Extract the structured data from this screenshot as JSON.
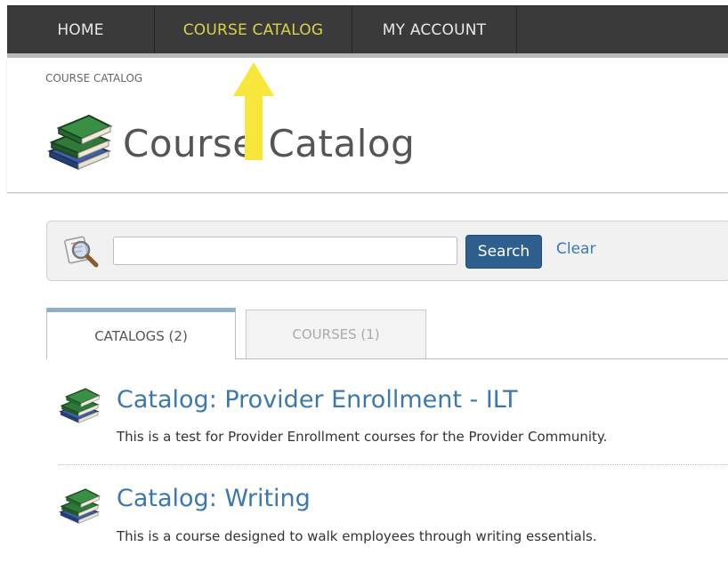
{
  "nav": {
    "items": [
      {
        "label": "HOME"
      },
      {
        "label": "COURSE CATALOG"
      },
      {
        "label": "MY ACCOUNT"
      }
    ],
    "active_color": "#d9d24a"
  },
  "breadcrumb": "COURSE CATALOG",
  "page_title": "Course Catalog",
  "search": {
    "value": "",
    "button_label": "Search",
    "clear_label": "Clear"
  },
  "tabs": [
    {
      "label": "CATALOGS (2)",
      "active": true
    },
    {
      "label": "COURSES (1)",
      "active": false
    }
  ],
  "catalogs": [
    {
      "title": "Catalog: Provider Enrollment - ILT",
      "description": "This is a test for Provider Enrollment courses for the Provider Community."
    },
    {
      "title": "Catalog: Writing",
      "description": "This is a course designed to walk employees through writing essentials."
    }
  ],
  "icons": {
    "books": "books-icon",
    "search": "magnifier-icon",
    "annotation": "arrow-up-icon"
  },
  "colors": {
    "nav_bg": "#3a3a3a",
    "link": "#3b78b0",
    "button": "#2f5f8f",
    "arrow": "#f5e23c"
  }
}
